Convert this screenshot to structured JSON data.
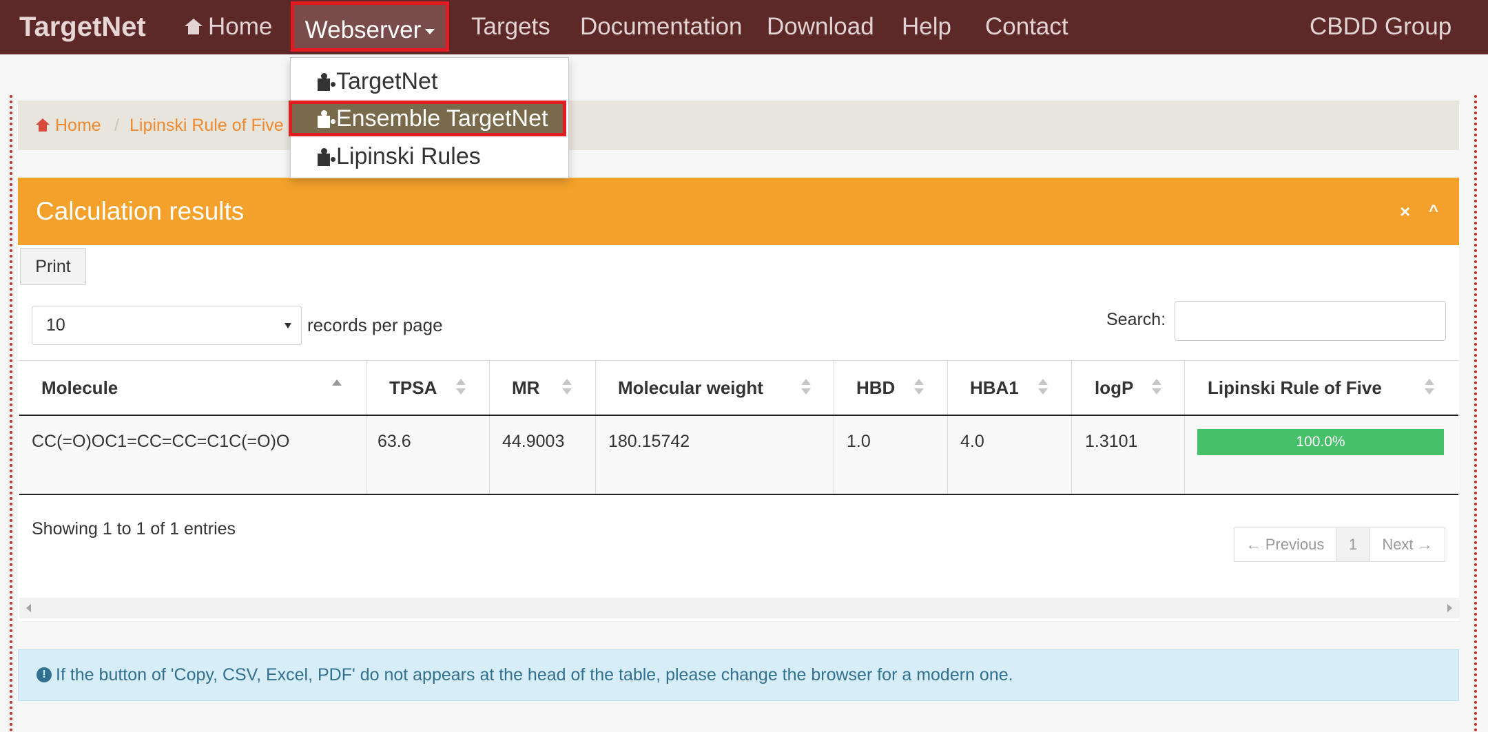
{
  "navbar": {
    "brand": "TargetNet",
    "home": "Home",
    "webserver": "Webserver",
    "targets": "Targets",
    "documentation": "Documentation",
    "download": "Download",
    "help": "Help",
    "contact": "Contact",
    "group": "CBDD Group"
  },
  "dropdown": {
    "items": [
      {
        "label": "TargetNet",
        "icon": "puzzle-icon"
      },
      {
        "label": "Ensemble TargetNet",
        "icon": "puzzle-icon"
      },
      {
        "label": "Lipinski Rules",
        "icon": "puzzle-icon"
      }
    ]
  },
  "breadcrumb": {
    "home": "Home",
    "separator": "/",
    "current": "Lipinski Rule of Five"
  },
  "panel": {
    "title": "Calculation results",
    "close_glyph": "×",
    "collapse_glyph": "^",
    "print_label": "Print",
    "length_value": "10",
    "length_label": "records per page",
    "search_label": "Search:",
    "search_value": ""
  },
  "table": {
    "columns": [
      "Molecule",
      "TPSA",
      "MR",
      "Molecular weight",
      "HBD",
      "HBA1",
      "logP",
      "Lipinski Rule of Five"
    ],
    "rows": [
      {
        "molecule": "CC(=O)OC1=CC=CC=C1C(=O)O",
        "tpsa": "63.6",
        "mr": "44.9003",
        "mw": "180.15742",
        "hbd": "1.0",
        "hba1": "4.0",
        "logp": "1.3101",
        "lipinski_label": "100.0%",
        "lipinski_fraction": 1.0
      }
    ],
    "info": "Showing 1 to 1 of 1 entries",
    "pager": {
      "prev": "← Previous",
      "page": "1",
      "next": "Next →"
    }
  },
  "alert": {
    "icon_glyph": "!",
    "text": "If the button of 'Copy, CSV, Excel, PDF' do not appears at the head of the table, please change the browser for a modern one."
  },
  "colors": {
    "navbar": "#5c2828",
    "accent": "#f4a12b",
    "highlight": "#e11b22",
    "progress": "#47c06a",
    "alert": "#d7edf7"
  }
}
